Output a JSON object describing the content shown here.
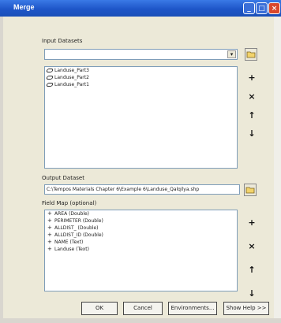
{
  "window": {
    "title": "Merge"
  },
  "window_controls": {
    "min": "_",
    "max": "□",
    "close": "×"
  },
  "input_datasets": {
    "label": "Input Datasets",
    "combo_value": "",
    "combo_arrow": "▾",
    "items": [
      "Landuse_Part3",
      "Landuse_Part2",
      "Landuse_Part1"
    ]
  },
  "side_buttons": {
    "add": "+",
    "remove": "×",
    "up": "↑",
    "down": "↓"
  },
  "output_dataset": {
    "label": "Output Dataset",
    "value": "C:\\Tempos Materials Chapter 6\\Example 6\\Landuse_Qalqilya.shp"
  },
  "field_map": {
    "label": "Field Map (optional)",
    "items": [
      "AREA (Double)",
      "PERIMETER (Double)",
      "ALLDIST_ (Double)",
      "ALLDIST_ID (Double)",
      "NAME (Text)",
      "Landuse (Text)"
    ]
  },
  "buttons": {
    "ok": "OK",
    "cancel": "Cancel",
    "environments": "Environments...",
    "show_help": "Show Help >>"
  }
}
